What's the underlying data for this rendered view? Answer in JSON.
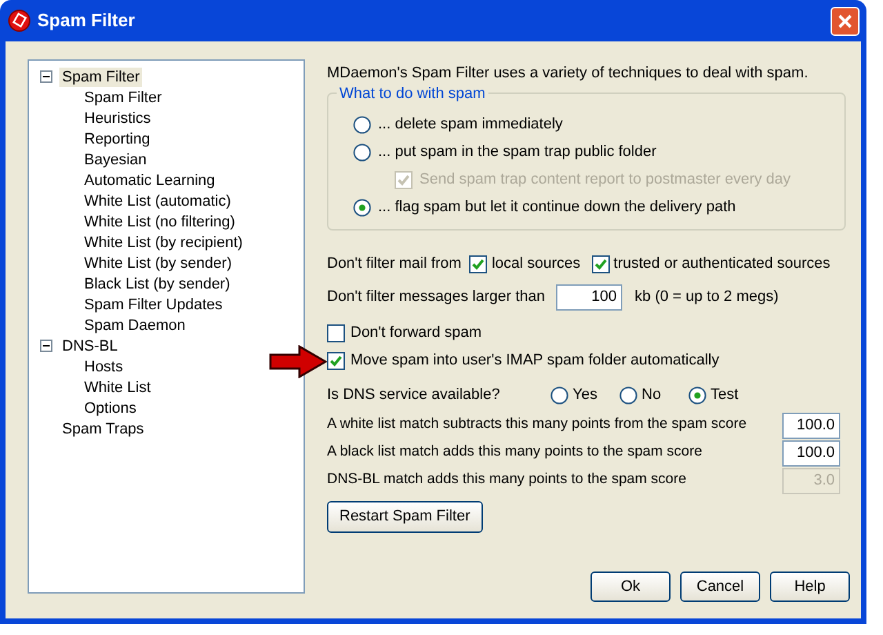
{
  "window": {
    "title": "Spam Filter"
  },
  "tree": [
    {
      "label": "Spam Filter",
      "expanded": true,
      "selected": true,
      "children": [
        {
          "label": "Spam Filter"
        },
        {
          "label": "Heuristics"
        },
        {
          "label": "Reporting"
        },
        {
          "label": "Bayesian"
        },
        {
          "label": "Automatic Learning"
        },
        {
          "label": "White List (automatic)"
        },
        {
          "label": "White List (no filtering)"
        },
        {
          "label": "White List (by recipient)"
        },
        {
          "label": "White List (by sender)"
        },
        {
          "label": "Black List (by sender)"
        },
        {
          "label": "Spam Filter Updates"
        },
        {
          "label": "Spam Daemon"
        }
      ]
    },
    {
      "label": "DNS-BL",
      "expanded": true,
      "selected": false,
      "children": [
        {
          "label": "Hosts"
        },
        {
          "label": "White List"
        },
        {
          "label": "Options"
        }
      ]
    },
    {
      "label": "Spam Traps",
      "selected": false
    }
  ],
  "intro": "MDaemon's Spam Filter uses a variety of techniques to deal with spam.",
  "group": {
    "title": "What to do with spam",
    "options": [
      {
        "kind": "radio",
        "label": "... delete spam immediately",
        "selected": false
      },
      {
        "kind": "radio",
        "label": "... put spam in the spam trap public folder",
        "selected": false
      },
      {
        "kind": "checkbox",
        "label": "Send spam trap content report to postmaster every day",
        "checked": true,
        "disabled": true
      },
      {
        "kind": "radio",
        "label": "... flag spam but let it continue down the delivery path",
        "selected": true
      }
    ]
  },
  "filter_from": {
    "label": "Don't filter mail from",
    "options": [
      {
        "label": "local sources",
        "checked": true
      },
      {
        "label": "trusted or authenticated sources",
        "checked": true
      }
    ]
  },
  "size_limit": {
    "label": "Don't filter messages larger than",
    "value": "100",
    "suffix": "kb (0 = up to 2 megs)"
  },
  "checks": [
    {
      "label": "Don't forward spam",
      "checked": false
    },
    {
      "label": "Move spam into user's IMAP spam folder automatically",
      "checked": true
    }
  ],
  "dns": {
    "label": "Is DNS service available?",
    "options": [
      {
        "label": "Yes",
        "selected": false
      },
      {
        "label": "No",
        "selected": false
      },
      {
        "label": "Test",
        "selected": true
      }
    ]
  },
  "scores": [
    {
      "label": "A white list match subtracts this many points from the spam score",
      "value": "100.0",
      "disabled": false
    },
    {
      "label": "A black list match adds this many points to the spam score",
      "value": "100.0",
      "disabled": false
    },
    {
      "label": "DNS-BL match adds this many points to the spam score",
      "value": "3.0",
      "disabled": true
    }
  ],
  "restart_button": "Restart Spam Filter",
  "buttons": [
    "Ok",
    "Cancel",
    "Help"
  ]
}
